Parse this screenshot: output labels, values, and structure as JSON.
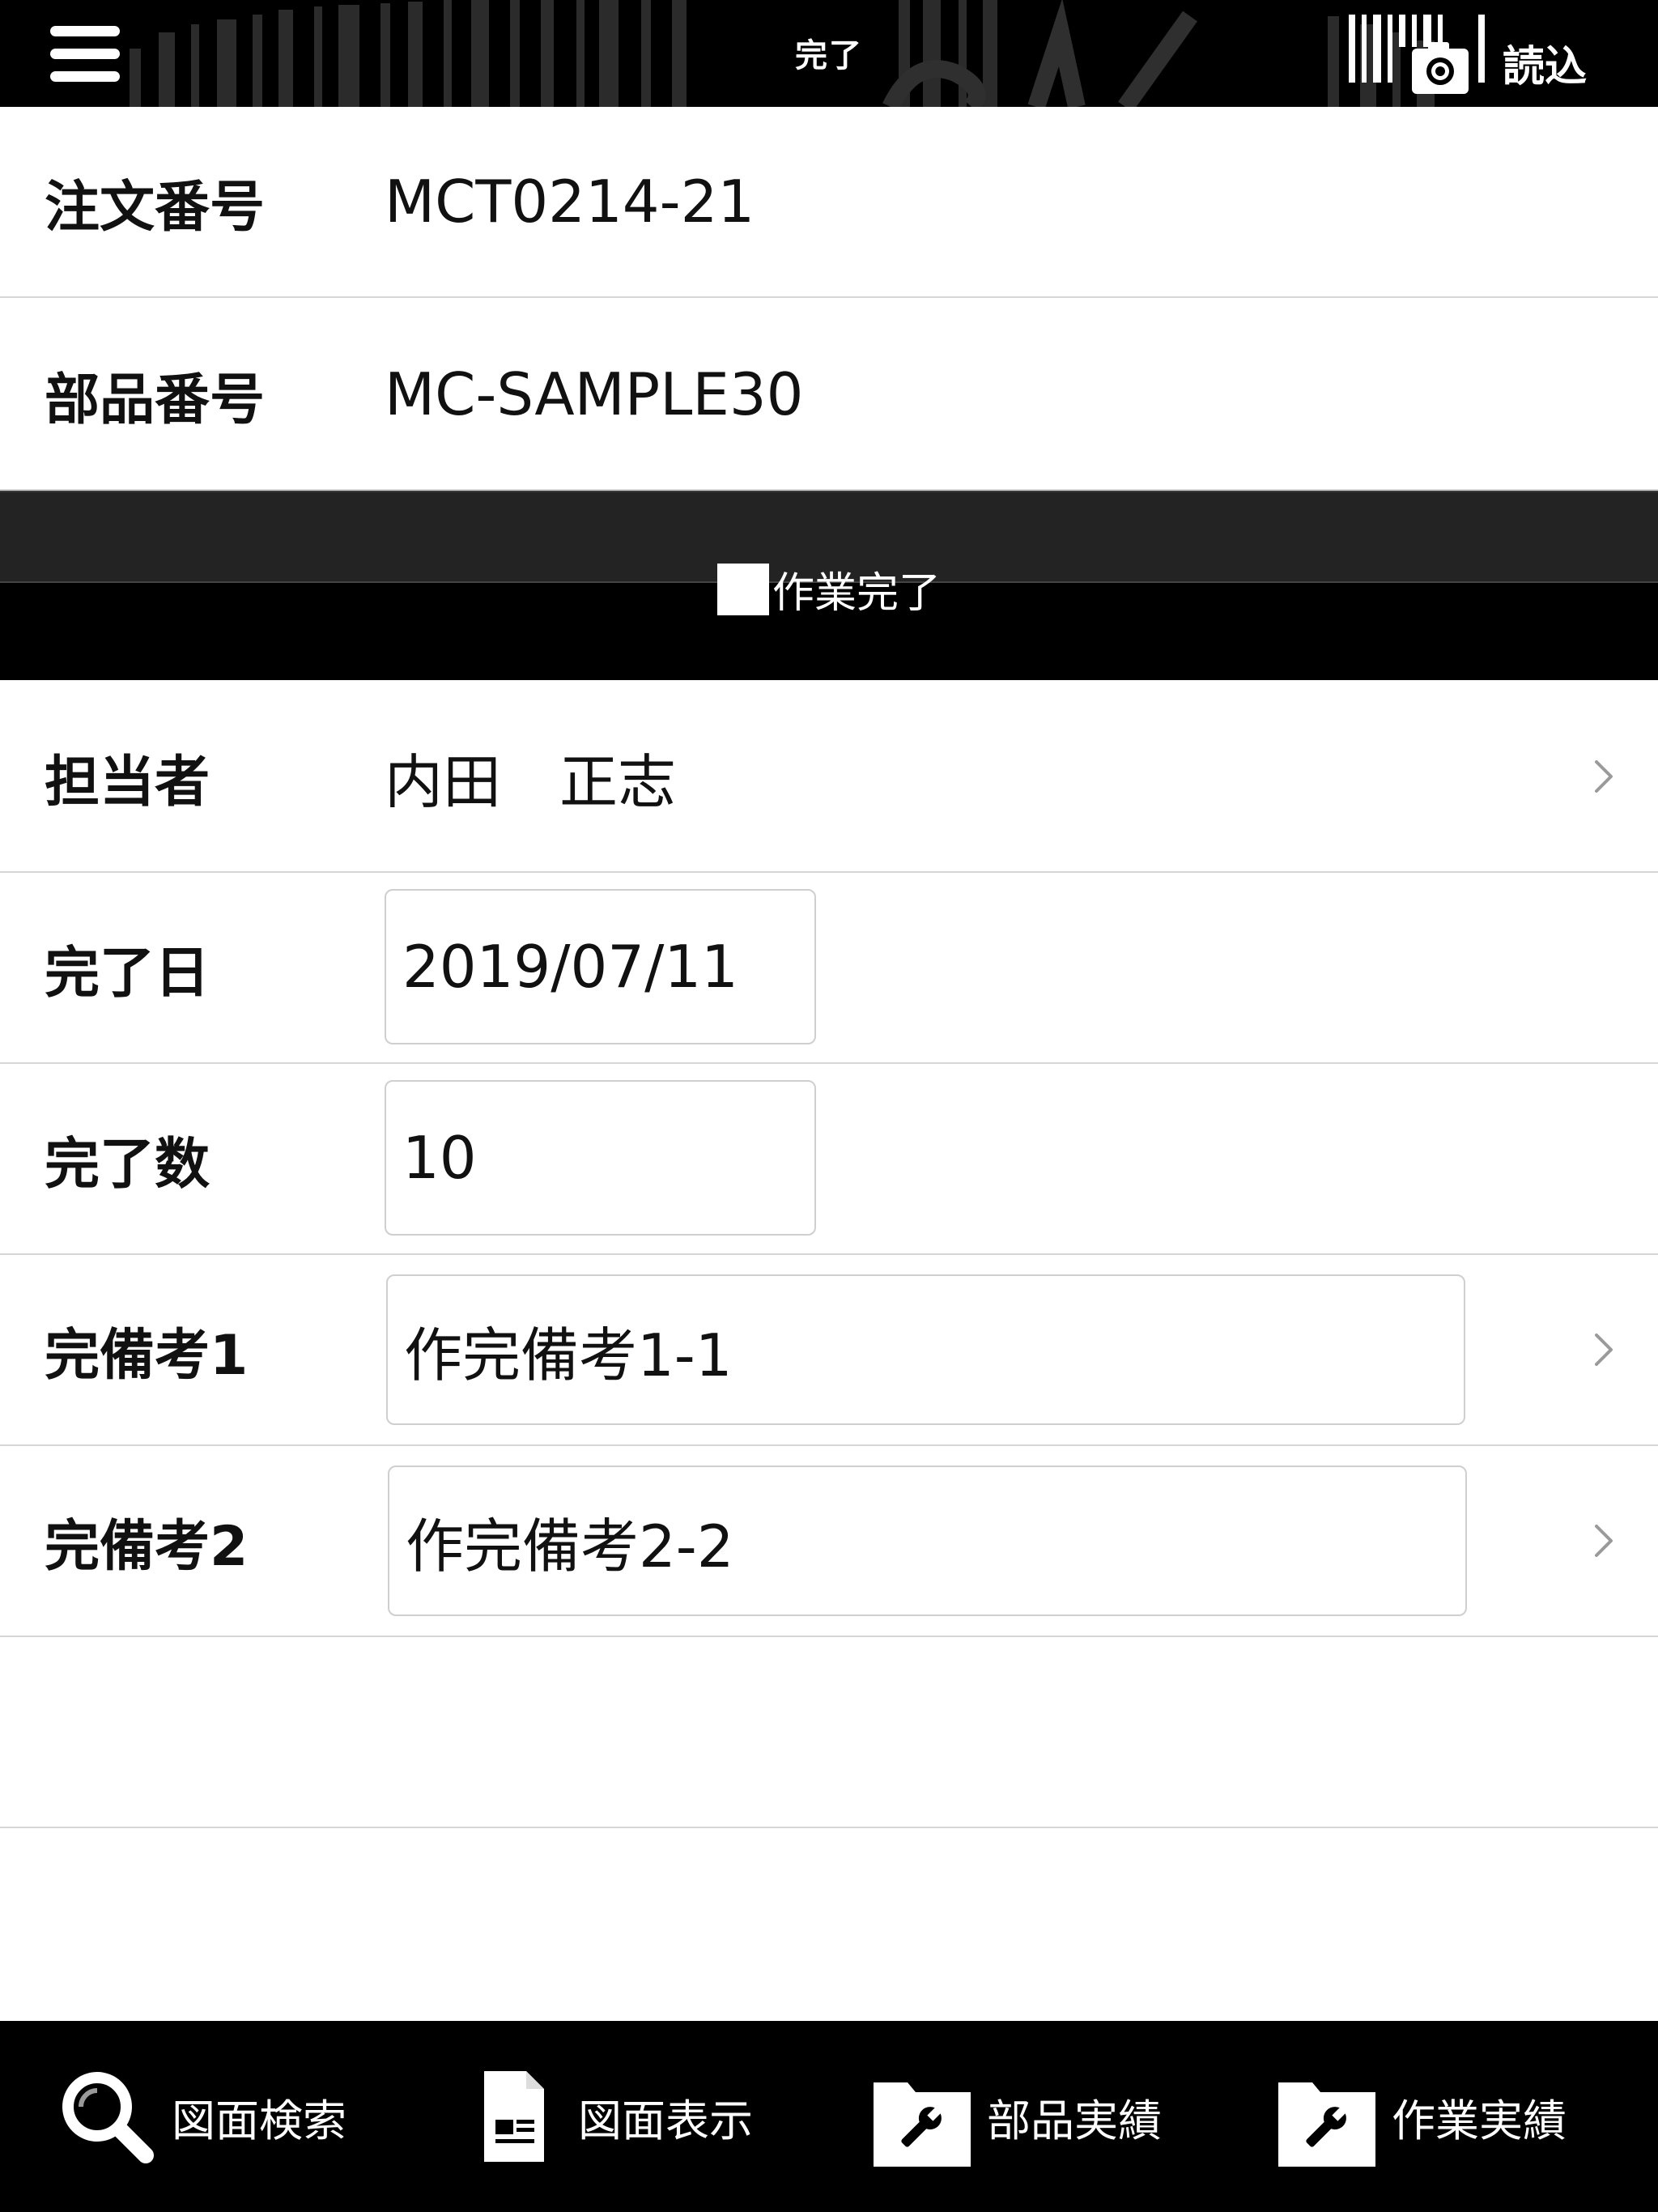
{
  "header": {
    "title": "完了",
    "scan_label": "読込"
  },
  "form": {
    "order_number": {
      "label": "注文番号",
      "value": "MCT0214-21"
    },
    "part_number": {
      "label": "部品番号",
      "value": "MC-SAMPLE30"
    },
    "work_complete": {
      "label": "作業完了",
      "checked": false
    },
    "assignee": {
      "label": "担当者",
      "value": "内田　正志"
    },
    "completion_date": {
      "label": "完了日",
      "value": "2019/07/11"
    },
    "completion_qty": {
      "label": "完了数",
      "value": "10"
    },
    "remark1": {
      "label": "完備考1",
      "value": "作完備考1-1"
    },
    "remark2": {
      "label": "完備考2",
      "value": "作完備考2-2"
    }
  },
  "tabbar": {
    "items": [
      {
        "label": "図面検索",
        "icon": "search-icon"
      },
      {
        "label": "図面表示",
        "icon": "document-icon"
      },
      {
        "label": "部品実績",
        "icon": "wrench-folder-icon"
      },
      {
        "label": "作業実績",
        "icon": "wrench-folder-icon"
      }
    ]
  },
  "colors": {
    "bar_background": "#000000",
    "band_top": "#232323",
    "divider": "#d6d6d6",
    "field_border": "#cfcfcf"
  }
}
